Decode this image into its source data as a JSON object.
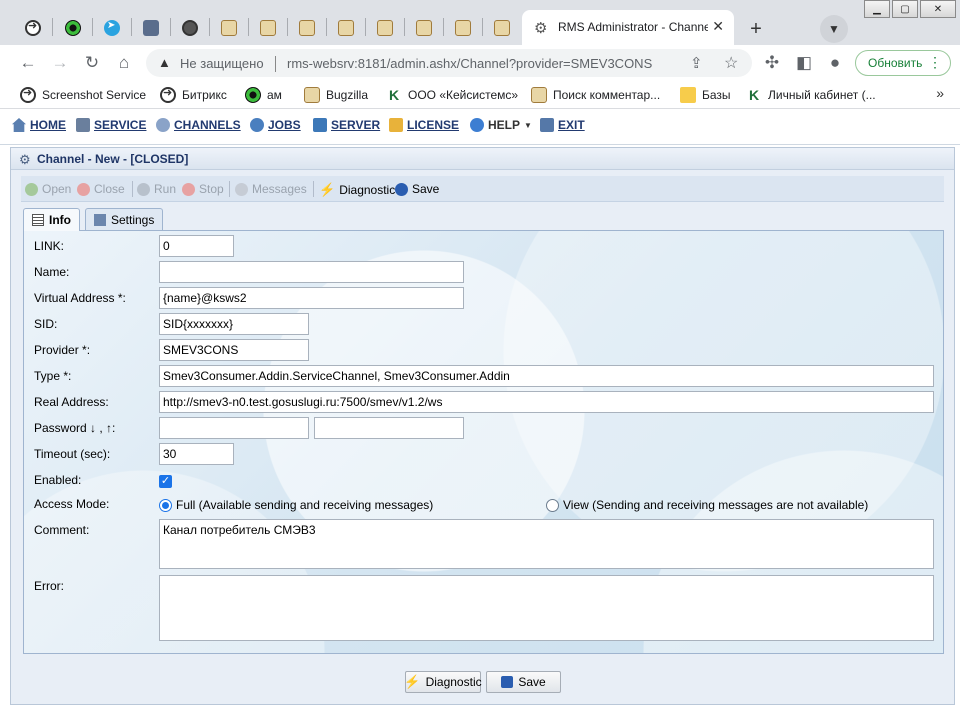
{
  "browser": {
    "active_tab_title": "RMS Administrator - Channel",
    "address_warning": "Не защищено",
    "url": "rms-websrv:8181/admin.ashx/Channel?provider=SMEV3CONS",
    "update_button": "Обновить",
    "bookmarks": [
      {
        "label": "Screenshot Service",
        "icon": "arrow-circle-icon"
      },
      {
        "label": "Битрикс",
        "icon": "arrow-circle-icon"
      },
      {
        "label": "ам",
        "icon": "green-flower-icon"
      },
      {
        "label": "Bugzilla",
        "icon": "document-icon"
      },
      {
        "label": "ООО «Кейсистемс»",
        "icon": "k-logo-icon"
      },
      {
        "label": "Поиск комментар...",
        "icon": "document-icon"
      },
      {
        "label": "Базы",
        "icon": "folder-icon"
      },
      {
        "label": "Личный кабинет (...",
        "icon": "k-logo-icon"
      }
    ]
  },
  "menu": {
    "home": "HOME",
    "service": "SERVICE",
    "channels": "CHANNELS",
    "jobs": "JOBS",
    "server": "SERVER",
    "license": "LICENSE",
    "help": "HELP",
    "exit": "EXIT"
  },
  "window": {
    "title": "Channel - New - [CLOSED]",
    "actions": {
      "open": "Open",
      "close": "Close",
      "run": "Run",
      "stop": "Stop",
      "messages": "Messages",
      "diagnostic": "Diagnostic",
      "save": "Save"
    },
    "tabs": {
      "info": "Info",
      "settings": "Settings"
    }
  },
  "form": {
    "link": {
      "label": "LINK:",
      "value": "0"
    },
    "name": {
      "label": "Name:",
      "value": ""
    },
    "virtual_address": {
      "label": "Virtual Address *:",
      "value": "{name}@ksws2"
    },
    "sid": {
      "label": "SID:",
      "value": "SID{xxxxxxx}"
    },
    "provider": {
      "label": "Provider *:",
      "value": "SMEV3CONS"
    },
    "type": {
      "label": "Type *:",
      "value": "Smev3Consumer.Addin.ServiceChannel, Smev3Consumer.Addin"
    },
    "real_address": {
      "label": "Real Address:",
      "value": "http://smev3-n0.test.gosuslugi.ru:7500/smev/v1.2/ws"
    },
    "password": {
      "label": "Password ↓ , ↑:",
      "value1": "",
      "value2": ""
    },
    "timeout": {
      "label": "Timeout (sec):",
      "value": "30"
    },
    "enabled": {
      "label": "Enabled:",
      "checked": true
    },
    "access_mode": {
      "label": "Access Mode:",
      "full": "Full (Available sending and receiving messages)",
      "view": "View (Sending and receiving messages are not available)",
      "selected": "full"
    },
    "comment": {
      "label": "Comment:",
      "value": "Канал потребитель СМЭВ3"
    },
    "error": {
      "label": "Error:",
      "value": ""
    }
  },
  "bottom": {
    "diagnostic": "Diagnostic",
    "save": "Save"
  }
}
